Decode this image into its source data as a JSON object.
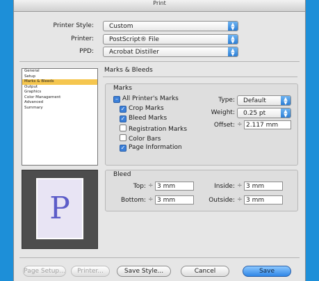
{
  "window": {
    "title": "Print"
  },
  "header_rows": [
    {
      "label": "Printer Style:",
      "value": "Custom"
    },
    {
      "label": "Printer:",
      "value": "PostScript® File"
    },
    {
      "label": "PPD:",
      "value": "Acrobat Distiller"
    }
  ],
  "sidebar": {
    "items": [
      "General",
      "Setup",
      "Marks & Bleeds",
      "Output",
      "Graphics",
      "Color Management",
      "Advanced",
      "Summary"
    ],
    "selected": "Marks & Bleeds"
  },
  "preview": {
    "glyph": "P"
  },
  "panel": {
    "title": "Marks & Bleeds"
  },
  "marks": {
    "title": "Marks",
    "all_printers_marks": "All Printer's Marks",
    "checkboxes": [
      {
        "label": "Crop Marks",
        "checked": true
      },
      {
        "label": "Bleed Marks",
        "checked": true
      },
      {
        "label": "Registration Marks",
        "checked": false
      },
      {
        "label": "Color Bars",
        "checked": false
      },
      {
        "label": "Page Information",
        "checked": true
      }
    ],
    "type_label": "Type:",
    "type_value": "Default",
    "weight_label": "Weight:",
    "weight_value": "0.25 pt",
    "offset_label": "Offset:",
    "offset_value": "2.117 mm"
  },
  "bleed": {
    "title": "Bleed",
    "top_label": "Top:",
    "top_value": "3 mm",
    "bottom_label": "Bottom:",
    "bottom_value": "3 mm",
    "inside_label": "Inside:",
    "inside_value": "3 mm",
    "outside_label": "Outside:",
    "outside_value": "3 mm"
  },
  "buttons": {
    "page_setup": "Page Setup...",
    "printer": "Printer...",
    "save_style": "Save Style...",
    "cancel": "Cancel",
    "save": "Save"
  },
  "colors": {
    "accent": "#3b7fd8",
    "selection": "#f5c64f",
    "background": "#1d8fd8"
  },
  "icons": {
    "popup_arrows": "up-down-arrows-icon",
    "checkmark": "checkmark-icon",
    "stepper": "stepper-arrows-icon"
  }
}
